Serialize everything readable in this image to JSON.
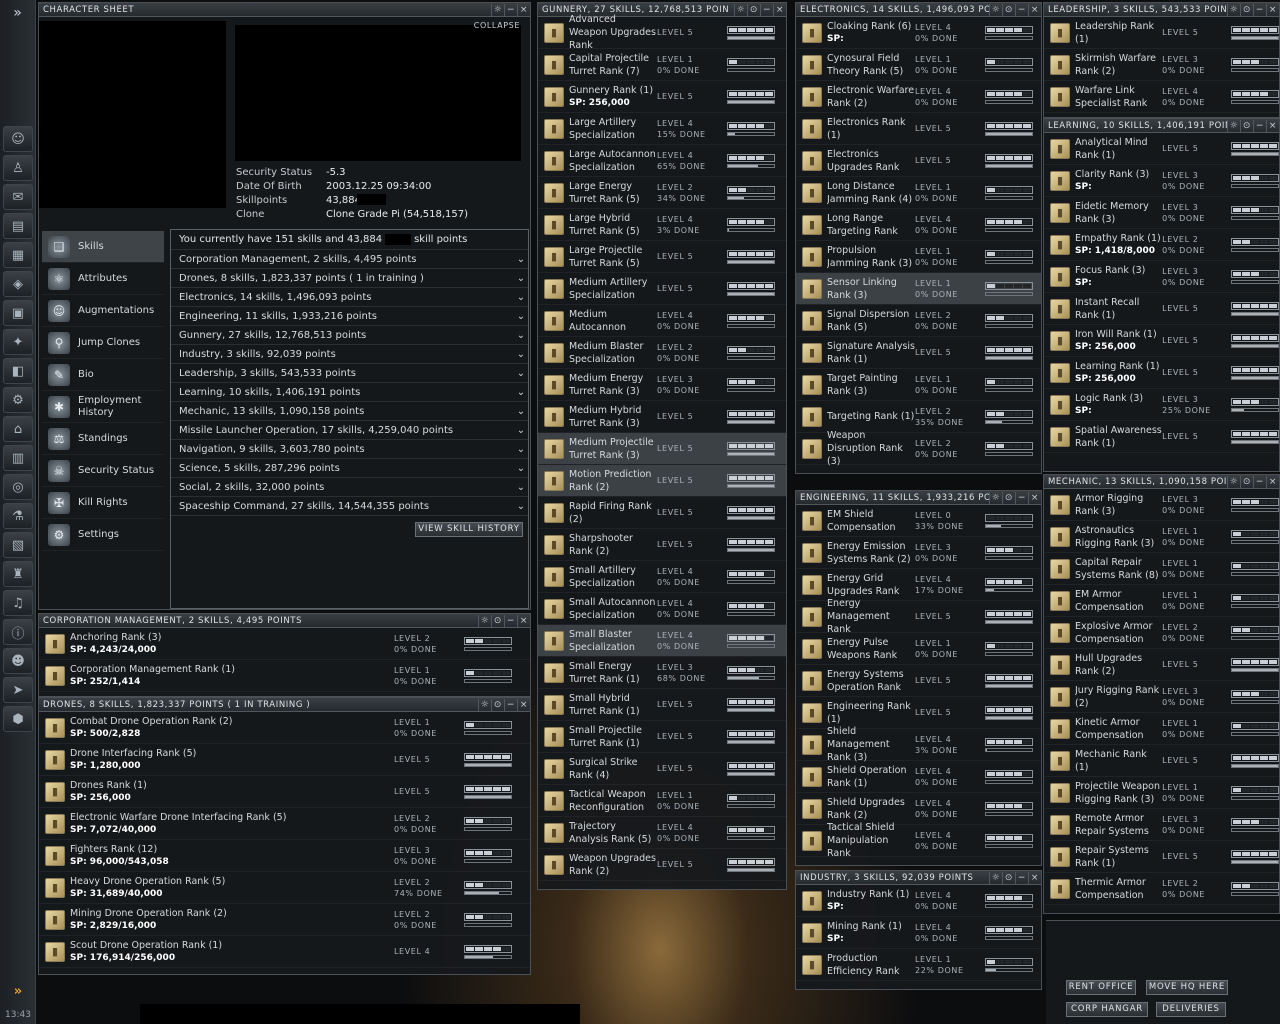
{
  "neocom": {
    "expand": "»",
    "clock": "13:43",
    "icons": [
      "character-icon",
      "people-icon",
      "mail-icon",
      "notepad-icon",
      "market-icon",
      "map-icon",
      "wallet-icon",
      "starmap-icon",
      "assets-icon",
      "fitting-icon",
      "industry-icon",
      "calculator-icon",
      "help-icon",
      "science-icon",
      "journal-icon",
      "corp-icon",
      "audio-icon",
      "info-icon",
      "portrait-icon",
      "ship-icon",
      "hangar-icon"
    ]
  },
  "character_sheet": {
    "title": "CHARACTER SHEET",
    "collapse": "COLLAPSE",
    "info": [
      {
        "k": "Security Status",
        "v": "-5.3"
      },
      {
        "k": "Date Of Birth",
        "v": "2003.12.25  09:34:00"
      },
      {
        "k": "Skillpoints",
        "v": "43,884"
      },
      {
        "k": "Clone",
        "v": "Clone Grade Pi (54,518,157)"
      }
    ],
    "menu": [
      {
        "label": "Skills",
        "icon": "book-icon"
      },
      {
        "label": "Attributes",
        "icon": "atom-icon"
      },
      {
        "label": "Augmentations",
        "icon": "head-icon"
      },
      {
        "label": "Jump Clones",
        "icon": "clone-icon"
      },
      {
        "label": "Bio",
        "icon": "bio-icon"
      },
      {
        "label": "Employment\nHistory",
        "icon": "employment-icon"
      },
      {
        "label": "Standings",
        "icon": "standings-icon"
      },
      {
        "label": "Security Status",
        "icon": "skull-icon"
      },
      {
        "label": "Kill Rights",
        "icon": "kill-icon"
      },
      {
        "label": "Settings",
        "icon": "settings-icon"
      }
    ],
    "summary": "You currently have 151 skills and 43,884",
    "summary_tail": "skill points",
    "groups": [
      "Corporation Management, 2 skills, 4,495 points",
      "Drones, 8 skills, 1,823,337 points ( 1 in training )",
      "Electronics, 14 skills, 1,496,093 points",
      "Engineering, 11 skills, 1,933,216 points",
      "Gunnery, 27 skills, 12,768,513 points",
      "Industry, 3 skills, 92,039 points",
      "Leadership, 3 skills, 543,533 points",
      "Learning, 10 skills, 1,406,191 points",
      "Mechanic, 13 skills, 1,090,158 points",
      "Missile Launcher Operation, 17 skills, 4,259,040 points",
      "Navigation, 9 skills, 3,603,780 points",
      "Science, 5 skills, 287,296 points",
      "Social, 2 skills, 32,000 points",
      "Spaceship Command, 27 skills, 14,544,355 points"
    ],
    "history_button": "VIEW SKILL HISTORY"
  },
  "windows": {
    "corp": {
      "title": "CORPORATION MANAGEMENT, 2 SKILLS, 4,495 POINTS",
      "skills": [
        {
          "n": "Anchoring Rank (3)",
          "sp": "SP: 4,243/24,000",
          "lv": "LEVEL 2\n0% DONE",
          "lvl": 2,
          "p": 0
        },
        {
          "n": "Corporation Management Rank (1)",
          "sp": "SP: 252/1,414",
          "lv": "LEVEL 1\n0% DONE",
          "lvl": 1,
          "p": 0
        }
      ]
    },
    "drones": {
      "title": "DRONES, 8 SKILLS, 1,823,337 POINTS ( 1 IN TRAINING )",
      "skills": [
        {
          "n": "Combat Drone Operation Rank (2)",
          "sp": "SP: 500/2,828",
          "lv": "LEVEL 1\n0% DONE",
          "lvl": 1,
          "p": 0
        },
        {
          "n": "Drone Interfacing Rank (5)",
          "sp": "SP: 1,280,000",
          "lv": "LEVEL 5",
          "lvl": 5,
          "p": 100
        },
        {
          "n": "Drones Rank (1)",
          "sp": "SP: 256,000",
          "lv": "LEVEL 5",
          "lvl": 5,
          "p": 100
        },
        {
          "n": "Electronic Warfare Drone Interfacing Rank (5)",
          "sp": "SP: 7,072/40,000",
          "lv": "LEVEL 2\n0% DONE",
          "lvl": 2,
          "p": 0
        },
        {
          "n": "Fighters Rank (12)",
          "sp": "SP: 96,000/543,058",
          "lv": "LEVEL 3\n0% DONE",
          "lvl": 3,
          "p": 0
        },
        {
          "n": "Heavy Drone Operation Rank (5)",
          "sp": "SP: 31,689/40,000",
          "lv": "LEVEL 2\n74% DONE",
          "lvl": 2,
          "p": 74
        },
        {
          "n": "Mining Drone Operation Rank (2)",
          "sp": "SP: 2,829/16,000",
          "lv": "LEVEL 2\n0% DONE",
          "lvl": 2,
          "p": 0
        },
        {
          "n": "Scout Drone Operation Rank (1)",
          "sp": "SP: 176,914/256,000",
          "lv": "LEVEL 4",
          "lvl": 4,
          "p": 60
        }
      ]
    },
    "gunnery": {
      "title": "GUNNERY, 27 SKILLS, 12,768,513 POIN",
      "skills": [
        {
          "n": "Advanced Weapon Upgrades Rank",
          "lv": "LEVEL 5",
          "lvl": 5,
          "p": 100
        },
        {
          "n": "Capital Projectile Turret Rank (7)",
          "lv": "LEVEL 1\n0% DONE",
          "lvl": 1,
          "p": 0
        },
        {
          "n": "Gunnery Rank (1)",
          "sp": "SP: 256,000",
          "lv": "LEVEL 5",
          "lvl": 5,
          "p": 100
        },
        {
          "n": "Large Artillery Specialization",
          "lv": "LEVEL 4\n15% DONE",
          "lvl": 4,
          "p": 15
        },
        {
          "n": "Large Autocannon Specialization",
          "lv": "LEVEL 4\n65% DONE",
          "lvl": 4,
          "p": 65
        },
        {
          "n": "Large Energy Turret Rank (5)",
          "lv": "LEVEL 2\n34% DONE",
          "lvl": 2,
          "p": 34
        },
        {
          "n": "Large Hybrid Turret Rank (5)",
          "lv": "LEVEL 4\n3% DONE",
          "lvl": 4,
          "p": 3
        },
        {
          "n": "Large Projectile Turret Rank (5)",
          "lv": "LEVEL 5",
          "lvl": 5,
          "p": 100
        },
        {
          "n": "Medium Artillery Specialization",
          "lv": "LEVEL 5",
          "lvl": 5,
          "p": 100
        },
        {
          "n": "Medium Autocannon",
          "lv": "LEVEL 4\n0% DONE",
          "lvl": 4,
          "p": 0
        },
        {
          "n": "Medium Blaster Specialization",
          "lv": "LEVEL 2\n0% DONE",
          "lvl": 2,
          "p": 0
        },
        {
          "n": "Medium Energy Turret Rank (3)",
          "lv": "LEVEL 3\n0% DONE",
          "lvl": 3,
          "p": 0
        },
        {
          "n": "Medium Hybrid Turret Rank (3)",
          "lv": "LEVEL 5",
          "lvl": 5,
          "p": 100
        },
        {
          "n": "Medium Projectile Turret Rank (3)",
          "lv": "LEVEL 5",
          "lvl": 5,
          "p": 100,
          "hl": true
        },
        {
          "n": "Motion Prediction Rank (2)",
          "lv": "LEVEL 5",
          "lvl": 5,
          "p": 100,
          "hl": true
        },
        {
          "n": "Rapid Firing Rank (2)",
          "lv": "LEVEL 5",
          "lvl": 5,
          "p": 100
        },
        {
          "n": "Sharpshooter Rank (2)",
          "lv": "LEVEL 5",
          "lvl": 5,
          "p": 100
        },
        {
          "n": "Small Artillery Specialization",
          "lv": "LEVEL 4\n0% DONE",
          "lvl": 4,
          "p": 0
        },
        {
          "n": "Small Autocannon Specialization",
          "lv": "LEVEL 4\n0% DONE",
          "lvl": 4,
          "p": 0
        },
        {
          "n": "Small Blaster Specialization",
          "lv": "LEVEL 4\n0% DONE",
          "lvl": 4,
          "p": 0,
          "hl": true
        },
        {
          "n": "Small Energy Turret Rank (1)",
          "lv": "LEVEL 3\n68% DONE",
          "lvl": 3,
          "p": 68
        },
        {
          "n": "Small Hybrid Turret Rank (1)",
          "lv": "LEVEL 5",
          "lvl": 5,
          "p": 100
        },
        {
          "n": "Small Projectile Turret Rank (1)",
          "lv": "LEVEL 5",
          "lvl": 5,
          "p": 100
        },
        {
          "n": "Surgical Strike Rank (4)",
          "lv": "LEVEL 5",
          "lvl": 5,
          "p": 100
        },
        {
          "n": "Tactical Weapon Reconfiguration",
          "lv": "LEVEL 1\n0% DONE",
          "lvl": 1,
          "p": 0
        },
        {
          "n": "Trajectory Analysis Rank (5)",
          "lv": "LEVEL 4\n0% DONE",
          "lvl": 4,
          "p": 0
        },
        {
          "n": "Weapon Upgrades Rank (2)",
          "lv": "LEVEL 5",
          "lvl": 5,
          "p": 100
        }
      ]
    },
    "electronics": {
      "title": "ELECTRONICS, 14 SKILLS, 1,496,093 PO",
      "skills": [
        {
          "n": "Cloaking Rank (6)",
          "sp": "SP:",
          "lv": "LEVEL 4\n0% DONE",
          "lvl": 4,
          "p": 0
        },
        {
          "n": "Cynosural Field Theory Rank (5)",
          "lv": "LEVEL 1\n0% DONE",
          "lvl": 1,
          "p": 0
        },
        {
          "n": "Electronic Warfare Rank (2)",
          "lv": "LEVEL 4\n0% DONE",
          "lvl": 4,
          "p": 0
        },
        {
          "n": "Electronics Rank (1)",
          "lv": "LEVEL 5",
          "lvl": 5,
          "p": 100
        },
        {
          "n": "Electronics Upgrades Rank",
          "lv": "LEVEL 5",
          "lvl": 5,
          "p": 100
        },
        {
          "n": "Long Distance Jamming Rank (4)",
          "lv": "LEVEL 1\n0% DONE",
          "lvl": 1,
          "p": 0
        },
        {
          "n": "Long Range Targeting Rank",
          "lv": "LEVEL 4\n0% DONE",
          "lvl": 4,
          "p": 0
        },
        {
          "n": "Propulsion Jamming Rank (3)",
          "lv": "LEVEL 1\n0% DONE",
          "lvl": 1,
          "p": 0
        },
        {
          "n": "Sensor Linking Rank (3)",
          "lv": "LEVEL 1\n0% DONE",
          "lvl": 1,
          "p": 0,
          "hl": true
        },
        {
          "n": "Signal Dispersion Rank (5)",
          "lv": "LEVEL 2\n0% DONE",
          "lvl": 2,
          "p": 0
        },
        {
          "n": "Signature Analysis Rank (1)",
          "lv": "LEVEL 5",
          "lvl": 5,
          "p": 100
        },
        {
          "n": "Target Painting Rank (3)",
          "lv": "LEVEL 1\n0% DONE",
          "lvl": 1,
          "p": 0
        },
        {
          "n": "Targeting Rank (1)",
          "lv": "LEVEL 2\n35% DONE",
          "lvl": 2,
          "p": 35
        },
        {
          "n": "Weapon Disruption Rank (3)",
          "lv": "LEVEL 2\n0% DONE",
          "lvl": 2,
          "p": 0
        }
      ]
    },
    "engineering": {
      "title": "ENGINEERING, 11 SKILLS, 1,933,216 PO",
      "skills": [
        {
          "n": "EM Shield Compensation",
          "lv": "LEVEL 0\n33% DONE",
          "lvl": 0,
          "p": 33
        },
        {
          "n": "Energy Emission Systems Rank (2)",
          "lv": "LEVEL 3\n0% DONE",
          "lvl": 3,
          "p": 0
        },
        {
          "n": "Energy Grid Upgrades Rank",
          "lv": "LEVEL 4\n17% DONE",
          "lvl": 4,
          "p": 17
        },
        {
          "n": "Energy Management Rank",
          "lv": "LEVEL 5",
          "lvl": 5,
          "p": 100
        },
        {
          "n": "Energy Pulse Weapons Rank",
          "lv": "LEVEL 1\n0% DONE",
          "lvl": 1,
          "p": 0
        },
        {
          "n": "Energy Systems Operation Rank",
          "lv": "LEVEL 5",
          "lvl": 5,
          "p": 100
        },
        {
          "n": "Engineering Rank (1)",
          "lv": "LEVEL 5",
          "lvl": 5,
          "p": 100
        },
        {
          "n": "Shield Management Rank (3)",
          "lv": "LEVEL 4\n3% DONE",
          "lvl": 4,
          "p": 3
        },
        {
          "n": "Shield Operation Rank (1)",
          "lv": "LEVEL 4\n0% DONE",
          "lvl": 4,
          "p": 0
        },
        {
          "n": "Shield Upgrades Rank (2)",
          "lv": "LEVEL 4\n0% DONE",
          "lvl": 4,
          "p": 0
        },
        {
          "n": "Tactical Shield Manipulation Rank",
          "lv": "LEVEL 4\n0% DONE",
          "lvl": 4,
          "p": 0
        }
      ]
    },
    "industry": {
      "title": "INDUSTRY, 3 SKILLS, 92,039 POINTS",
      "skills": [
        {
          "n": "Industry Rank (1)",
          "sp": "SP:",
          "lv": "LEVEL 4\n0% DONE",
          "lvl": 4,
          "p": 0
        },
        {
          "n": "Mining Rank (1)",
          "sp": "SP:",
          "lv": "LEVEL 4\n0% DONE",
          "lvl": 4,
          "p": 0
        },
        {
          "n": "Production Efficiency Rank",
          "lv": "LEVEL 1\n22% DONE",
          "lvl": 1,
          "p": 22
        }
      ]
    },
    "leadership": {
      "title": "LEADERSHIP, 3 SKILLS, 543,533 POINTS",
      "skills": [
        {
          "n": "Leadership Rank (1)",
          "lv": "LEVEL 5",
          "lvl": 5,
          "p": 100
        },
        {
          "n": "Skirmish Warfare Rank (2)",
          "lv": "LEVEL 3\n0% DONE",
          "lvl": 3,
          "p": 0
        },
        {
          "n": "Warfare Link Specialist Rank",
          "lv": "LEVEL 4\n0% DONE",
          "lvl": 4,
          "p": 0
        }
      ]
    },
    "learning": {
      "title": "LEARNING, 10 SKILLS, 1,406,191 POINT",
      "skills": [
        {
          "n": "Analytical Mind Rank (1)",
          "lv": "LEVEL 5",
          "lvl": 5,
          "p": 100
        },
        {
          "n": "Clarity Rank (3)",
          "sp": "SP:",
          "lv": "LEVEL 3\n0% DONE",
          "lvl": 3,
          "p": 0
        },
        {
          "n": "Eidetic Memory Rank (3)",
          "lv": "LEVEL 3\n0% DONE",
          "lvl": 3,
          "p": 0
        },
        {
          "n": "Empathy Rank (1)",
          "sp": "SP: 1,418/8,000",
          "lv": "LEVEL 2\n0% DONE",
          "lvl": 2,
          "p": 0
        },
        {
          "n": "Focus Rank (3)",
          "sp": "SP:",
          "lv": "LEVEL 3\n0% DONE",
          "lvl": 3,
          "p": 0
        },
        {
          "n": "Instant Recall Rank (1)",
          "lv": "LEVEL 5",
          "lvl": 5,
          "p": 100
        },
        {
          "n": "Iron Will Rank (1)",
          "sp": "SP: 256,000",
          "lv": "LEVEL 5",
          "lvl": 5,
          "p": 100
        },
        {
          "n": "Learning Rank (1)",
          "sp": "SP: 256,000",
          "lv": "LEVEL 5",
          "lvl": 5,
          "p": 100
        },
        {
          "n": "Logic Rank (3)",
          "sp": "SP:",
          "lv": "LEVEL 3\n25% DONE",
          "lvl": 3,
          "p": 25
        },
        {
          "n": "Spatial Awareness Rank (1)",
          "lv": "LEVEL 5",
          "lvl": 5,
          "p": 100
        }
      ]
    },
    "mechanic": {
      "title": "MECHANIC, 13 SKILLS, 1,090,158 POIN",
      "skills": [
        {
          "n": "Armor Rigging Rank (3)",
          "lv": "LEVEL 3\n0% DONE",
          "lvl": 3,
          "p": 0
        },
        {
          "n": "Astronautics Rigging Rank (3)",
          "lv": "LEVEL 1\n0% DONE",
          "lvl": 1,
          "p": 0
        },
        {
          "n": "Capital Repair Systems Rank (8)",
          "lv": "LEVEL 1\n0% DONE",
          "lvl": 1,
          "p": 0
        },
        {
          "n": "EM Armor Compensation",
          "lv": "LEVEL 1\n0% DONE",
          "lvl": 1,
          "p": 0
        },
        {
          "n": "Explosive Armor Compensation",
          "lv": "LEVEL 2\n0% DONE",
          "lvl": 2,
          "p": 0
        },
        {
          "n": "Hull Upgrades Rank (2)",
          "lv": "LEVEL 5",
          "lvl": 5,
          "p": 100
        },
        {
          "n": "Jury Rigging Rank (2)",
          "lv": "LEVEL 3\n0% DONE",
          "lvl": 3,
          "p": 0
        },
        {
          "n": "Kinetic Armor Compensation",
          "lv": "LEVEL 1\n0% DONE",
          "lvl": 1,
          "p": 0
        },
        {
          "n": "Mechanic Rank (1)",
          "lv": "LEVEL 5",
          "lvl": 5,
          "p": 100
        },
        {
          "n": "Projectile Weapon Rigging Rank (3)",
          "lv": "LEVEL 1\n0% DONE",
          "lvl": 1,
          "p": 0
        },
        {
          "n": "Remote Armor Repair Systems",
          "lv": "LEVEL 3\n0% DONE",
          "lvl": 3,
          "p": 0
        },
        {
          "n": "Repair Systems Rank (1)",
          "lv": "LEVEL 5",
          "lvl": 5,
          "p": 100
        },
        {
          "n": "Thermic Armor Compensation",
          "lv": "LEVEL 2\n0% DONE",
          "lvl": 2,
          "p": 0
        }
      ]
    }
  },
  "corp_buttons": [
    "RENT OFFICE",
    "MOVE HQ HERE",
    "CORP HANGAR",
    "DELIVERIES"
  ]
}
